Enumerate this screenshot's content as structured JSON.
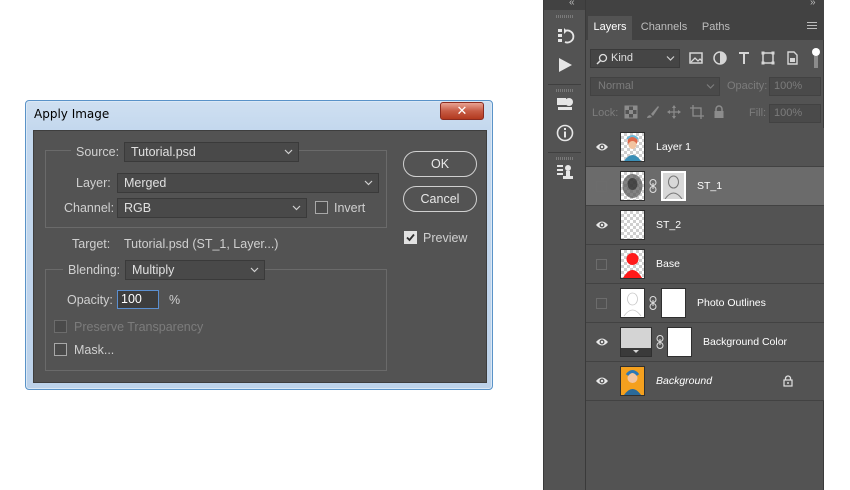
{
  "dialog": {
    "title": "Apply Image",
    "close_glyph": "✕",
    "source": {
      "label": "Source:",
      "value": "Tutorial.psd"
    },
    "layer": {
      "label": "Layer:",
      "value": "Merged"
    },
    "channel": {
      "label": "Channel:",
      "value": "RGB"
    },
    "invert": {
      "label": "Invert",
      "checked": false
    },
    "target": {
      "label": "Target:",
      "value": "Tutorial.psd (ST_1, Layer...)"
    },
    "blending": {
      "label": "Blending:",
      "value": "Multiply"
    },
    "opacity": {
      "label": "Opacity:",
      "value": "100",
      "unit": "%"
    },
    "preserve_transparency": {
      "label": "Preserve Transparency",
      "checked": false,
      "disabled": true
    },
    "mask": {
      "label": "Mask...",
      "checked": false
    },
    "ok_label": "OK",
    "cancel_label": "Cancel",
    "preview": {
      "label": "Preview",
      "checked": true
    }
  },
  "toolstrip": {
    "collapse_glyph": "«",
    "icons": [
      "history-icon",
      "play-actions-icon",
      "properties-icon",
      "info-icon",
      "clone-source-icon"
    ]
  },
  "layers_panel": {
    "collapse_glyph": "»",
    "tabs": [
      {
        "label": "Layers",
        "active": true
      },
      {
        "label": "Channels",
        "active": false
      },
      {
        "label": "Paths",
        "active": false
      }
    ],
    "kind_filter": "Kind",
    "blend_mode": "Normal",
    "opacity_label": "Opacity:",
    "opacity_value": "100%",
    "lock_label": "Lock:",
    "fill_label": "Fill:",
    "fill_value": "100%",
    "layers": [
      {
        "name": "Layer 1",
        "visible": true,
        "selected": false,
        "has_mask": false,
        "italic": false,
        "locked": false
      },
      {
        "name": "ST_1",
        "visible": false,
        "selected": true,
        "has_mask": true,
        "italic": false,
        "locked": false
      },
      {
        "name": "ST_2",
        "visible": true,
        "selected": false,
        "has_mask": false,
        "italic": false,
        "locked": false
      },
      {
        "name": "Base",
        "visible": false,
        "selected": false,
        "has_mask": false,
        "italic": false,
        "locked": false
      },
      {
        "name": "Photo Outlines",
        "visible": false,
        "selected": false,
        "has_mask": true,
        "italic": false,
        "locked": false
      },
      {
        "name": "Background Color",
        "visible": true,
        "selected": false,
        "has_mask": true,
        "italic": false,
        "locked": false
      },
      {
        "name": "Background",
        "visible": true,
        "selected": false,
        "has_mask": false,
        "italic": true,
        "locked": true
      }
    ]
  },
  "colors": {
    "panel_bg": "#535353",
    "dark_bg": "#424242",
    "selected_row": "#6b6b6b",
    "dialog_frame": "#bcd2ea",
    "close_red": "#c75c45",
    "focus_blue": "#5b8fd0"
  }
}
